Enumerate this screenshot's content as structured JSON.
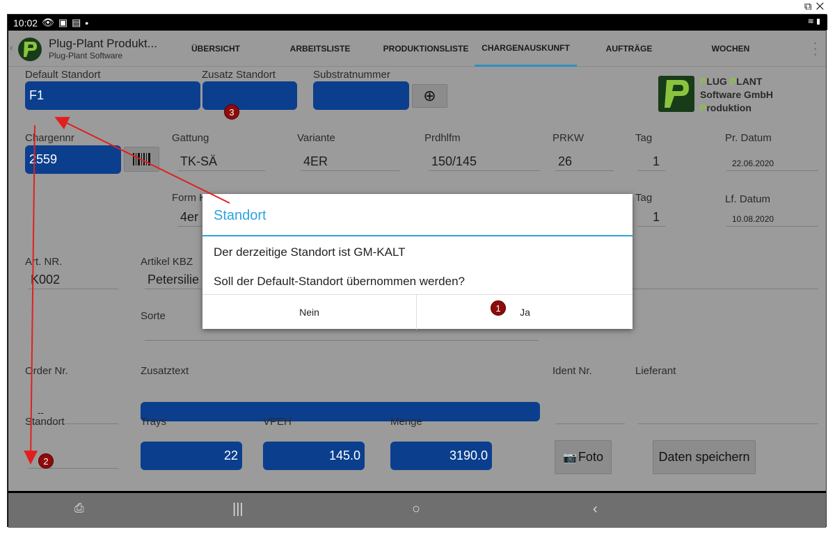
{
  "status": {
    "time": "10:02"
  },
  "app": {
    "title": "Plug-Plant Produkt...",
    "subtitle": "Plug-Plant Software"
  },
  "tabs": [
    {
      "label": "ÜBERSICHT"
    },
    {
      "label": "ARBEITSLISTE"
    },
    {
      "label": "PRODUKTIONSLISTE"
    },
    {
      "label": "CHARGENAUSKUNFT"
    },
    {
      "label": "AUFTRÄGE"
    },
    {
      "label": "WOCHEN"
    }
  ],
  "logo": {
    "line1a": "LUG ",
    "line1b": "LANT",
    "line2": "Software GmbH",
    "line3": "roduktion"
  },
  "labels": {
    "default_standort": "Default Standort",
    "zusatz_standort": "Zusatz Standort",
    "substratnummer": "Substratnummer",
    "chargennr": "Chargennr",
    "gattung": "Gattung",
    "variante": "Variante",
    "prdhlfm": "Prdhlfm",
    "prkw": "PRKW",
    "tag": "Tag",
    "pr_datum": "Pr. Datum",
    "form": "Form K",
    "tag2": "Tag",
    "lf_datum": "Lf. Datum",
    "art_nr": "Art. NR.",
    "artikel_kbz": "Artikel KBZ",
    "sorte": "Sorte",
    "order_nr": "Order Nr.",
    "zusatztext": "Zusatztext",
    "ident_nr": "Ident Nr.",
    "lieferant": "Lieferant",
    "standort": "Standort",
    "trays": "Trays",
    "vpeh": "VPEH",
    "menge": "Menge"
  },
  "values": {
    "default_standort": "F1",
    "chargennr": "2559",
    "gattung": "TK-SÄ",
    "variante": "4ER",
    "prdhlfm": "150/145",
    "prkw": "26",
    "tag": "1",
    "pr_datum": "22.06.2020",
    "form": "4er",
    "tag2": "1",
    "lf_datum": "10.08.2020",
    "art_nr": "K002",
    "artikel_kbz": "Petersilie",
    "order_nr": "--",
    "trays": "22",
    "vpeh": "145.0",
    "menge": "3190.0"
  },
  "buttons": {
    "add": "⊕",
    "foto": "Foto",
    "speichern": "Daten speichern"
  },
  "dialog": {
    "title": "Standort",
    "message1": "Der derzeitige Standort ist GM-KALT",
    "message2": "Soll der Default-Standort übernommen werden?",
    "no": "Nein",
    "yes": "Ja"
  },
  "badges": [
    "1",
    "2",
    "3"
  ],
  "colors": {
    "accent": "#2aa5dc",
    "field_blue": "#0b3f8e",
    "badge_red": "#8d0b0b",
    "arrow": "#e02020"
  }
}
